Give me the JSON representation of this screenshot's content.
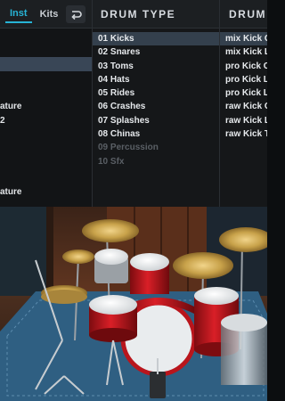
{
  "tabs": {
    "inst": "Inst",
    "kits": "Kits",
    "refresh_icon": "loop-arrow-icon"
  },
  "library": {
    "items": [
      "",
      "",
      "",
      "",
      "",
      "ature",
      "2",
      "",
      "",
      "",
      "",
      "ature",
      ""
    ],
    "selected_index": 2
  },
  "drum_type": {
    "header": "DRUM TYPE",
    "items": [
      "01 Kicks",
      "02 Snares",
      "03 Toms",
      "04 Hats",
      "05 Rides",
      "06 Crashes",
      "07 Splashes",
      "08 Chinas",
      "09 Percussion",
      "10 Sfx"
    ],
    "selected_index": 0,
    "dimmed": [
      8,
      9
    ]
  },
  "drum_kit": {
    "header": "DRUM",
    "items": [
      "mix Kick C",
      "mix Kick L",
      "pro Kick C",
      "pro Kick L",
      "pro Kick L",
      "raw Kick C",
      "raw Kick L",
      "raw Kick T"
    ],
    "selected_index": 0
  },
  "scene": {
    "name": "drum-kit-stage",
    "colors": {
      "shell_red": "#c0161d",
      "cymbal_gold": "#c8a24a",
      "rug_blue": "#2f5f82",
      "wall_wood": "#6a3a22"
    }
  }
}
